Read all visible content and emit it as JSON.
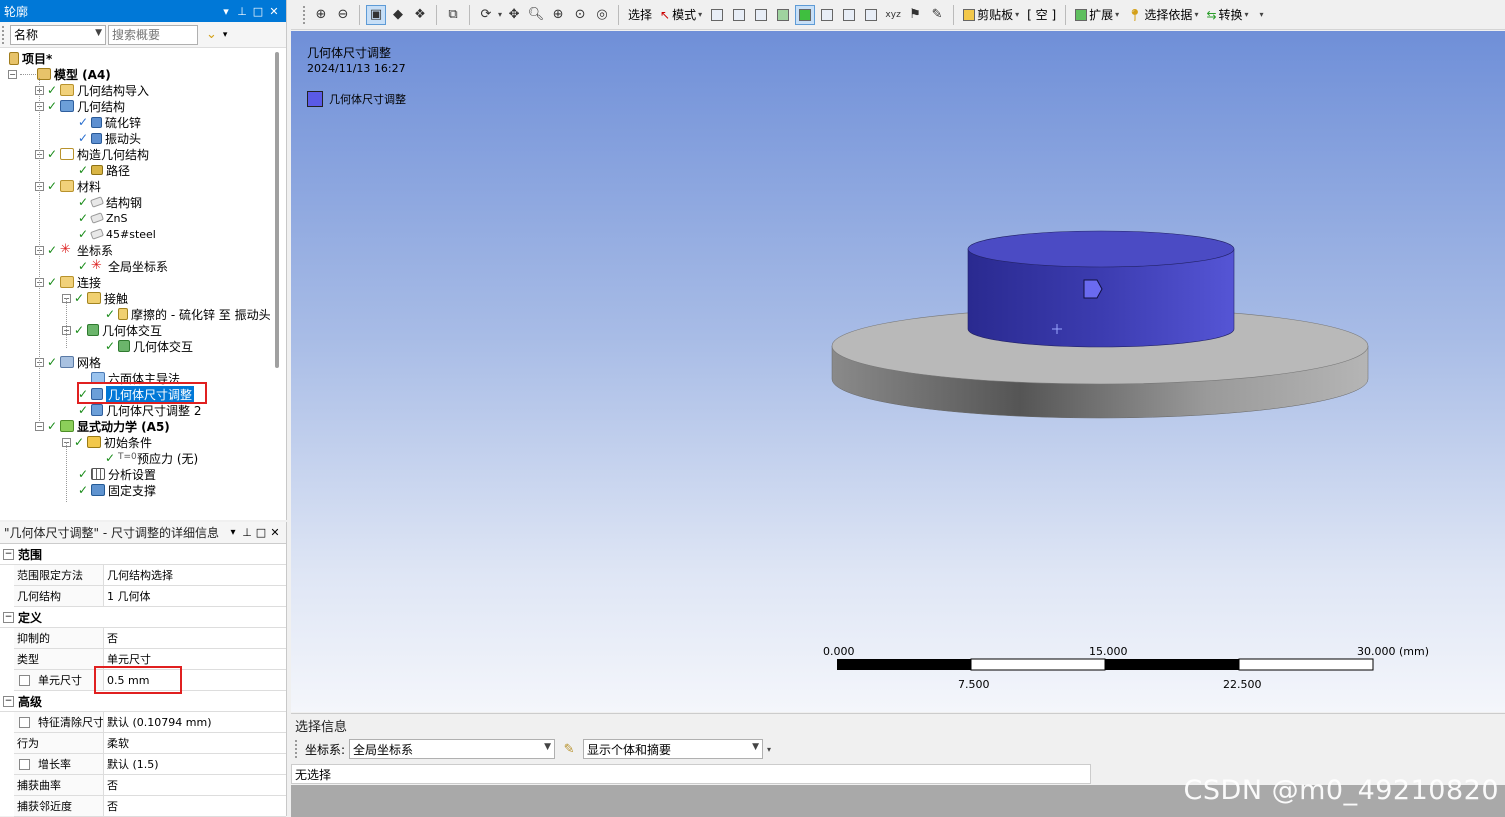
{
  "outline": {
    "title": "轮廓",
    "filter": {
      "column": "名称",
      "search_placeholder": "搜索概要"
    },
    "tree": [
      {
        "label": "项目*",
        "icon": "project-icon"
      },
      {
        "label": "模型 (A4)",
        "icon": "model-icon"
      },
      {
        "label": "几何结构导入",
        "icon": "geometry-import-icon"
      },
      {
        "label": "几何结构",
        "icon": "geometry-icon"
      },
      {
        "label": "硫化锌",
        "icon": "body-icon"
      },
      {
        "label": "振动头",
        "icon": "body-icon"
      },
      {
        "label": "构造几何结构",
        "icon": "construction-geometry-icon"
      },
      {
        "label": "路径",
        "icon": "path-icon"
      },
      {
        "label": "材料",
        "icon": "materials-icon"
      },
      {
        "label": "结构钢",
        "icon": "material-icon"
      },
      {
        "label": "ZnS",
        "icon": "material-icon"
      },
      {
        "label": "45#steel",
        "icon": "material-icon"
      },
      {
        "label": "坐标系",
        "icon": "coordinate-systems-icon"
      },
      {
        "label": "全局坐标系",
        "icon": "coordinate-system-icon"
      },
      {
        "label": "连接",
        "icon": "connections-icon"
      },
      {
        "label": "接触",
        "icon": "contacts-icon"
      },
      {
        "label": "摩擦的 - 硫化锌 至 振动头",
        "icon": "contact-region-icon"
      },
      {
        "label": "几何体交互",
        "icon": "body-interactions-icon"
      },
      {
        "label": "几何体交互",
        "icon": "body-interaction-icon"
      },
      {
        "label": "网格",
        "icon": "mesh-icon"
      },
      {
        "label": "六面体主导法",
        "icon": "hex-dominant-icon"
      },
      {
        "label": "几何体尺寸调整",
        "icon": "sizing-icon"
      },
      {
        "label": "几何体尺寸调整 2",
        "icon": "sizing-icon"
      },
      {
        "label": "显式动力学 (A5)",
        "icon": "explicit-dynamics-icon"
      },
      {
        "label": "初始条件",
        "icon": "initial-conditions-icon"
      },
      {
        "label": "预应力 (无)",
        "icon": "pre-stress-icon"
      },
      {
        "label": "分析设置",
        "icon": "analysis-settings-icon"
      },
      {
        "label": "固定支撑",
        "icon": "fixed-support-icon"
      }
    ]
  },
  "details": {
    "title": "\"几何体尺寸调整\" - 尺寸调整的详细信息",
    "sections": [
      {
        "name": "范围",
        "rows": [
          {
            "name": "范围限定方法",
            "value": "几何结构选择"
          },
          {
            "name": "几何结构",
            "value": "1 几何体"
          }
        ]
      },
      {
        "name": "定义",
        "rows": [
          {
            "name": "抑制的",
            "value": "否"
          },
          {
            "name": "类型",
            "value": "单元尺寸"
          },
          {
            "name": "单元尺寸",
            "value": "0.5 mm"
          }
        ]
      },
      {
        "name": "高级",
        "rows": [
          {
            "name": "特征清除尺寸",
            "value": "默认 (0.10794 mm)"
          },
          {
            "name": "行为",
            "value": "柔软"
          },
          {
            "name": "增长率",
            "value": "默认 (1.5)"
          },
          {
            "name": "捕获曲率",
            "value": "否"
          },
          {
            "name": "捕获邻近度",
            "value": "否"
          }
        ]
      }
    ]
  },
  "toolbar": {
    "select": "选择",
    "mode": "模式",
    "clipboard": "剪贴板",
    "empty": "[ 空 ]",
    "extend": "扩展",
    "select_by": "选择依据",
    "convert": "转换"
  },
  "viewport": {
    "title": "几何体尺寸调整",
    "date": "2024/11/13 16:27",
    "legend": "几何体尺寸调整",
    "scale": {
      "top": [
        "0.000",
        "15.000",
        "30.000 (mm)"
      ],
      "bottom": [
        "7.500",
        "22.500"
      ]
    }
  },
  "selection_info": {
    "title": "选择信息",
    "coord_label": "坐标系:",
    "coord_value": "全局坐标系",
    "display_value": "显示个体和摘要",
    "status": "无选择"
  },
  "watermark": "CSDN @m0_49210820",
  "colors": {
    "selection": "#0078d7",
    "highlight_box": "#e02020",
    "body_cylinder": "#4848c8",
    "base_disc": "#a0a0a0"
  }
}
